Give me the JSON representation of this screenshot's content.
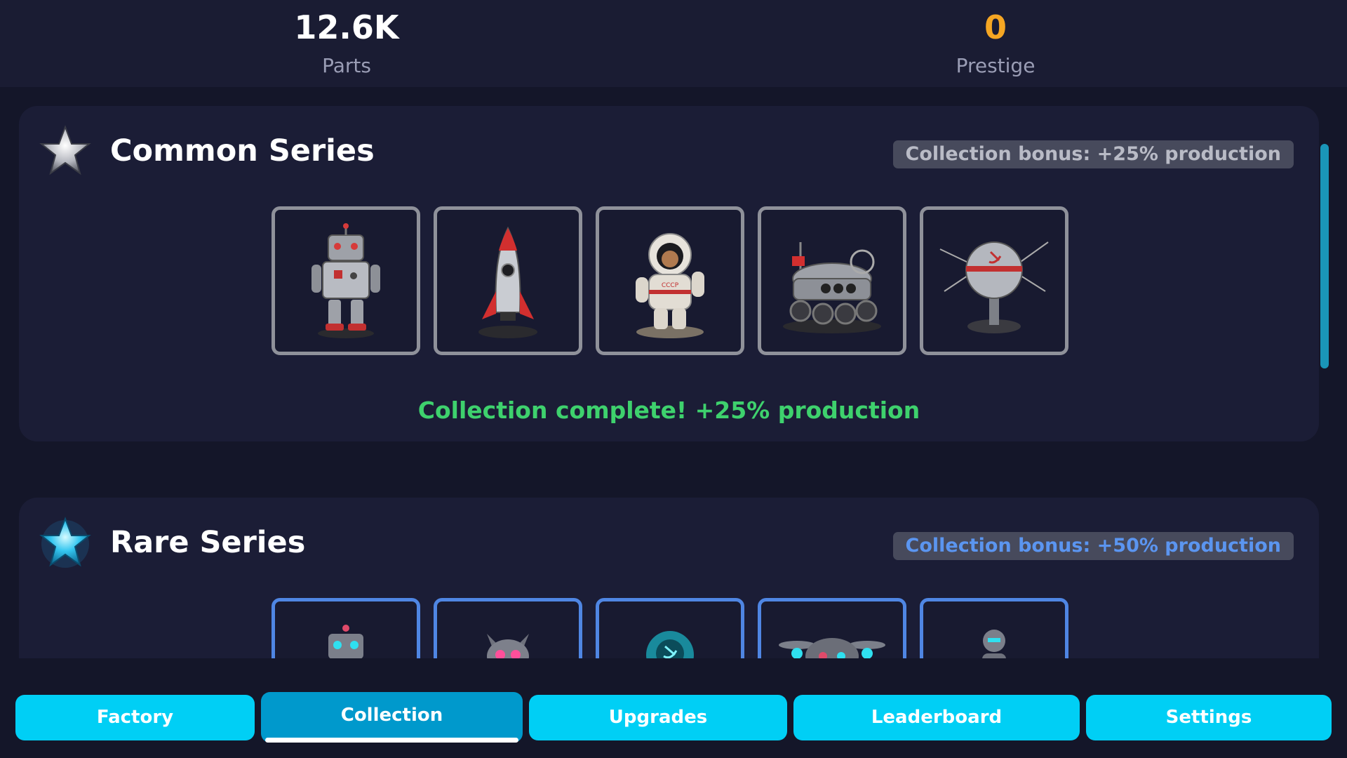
{
  "stats": {
    "parts": {
      "value": "12.6K",
      "label": "Parts"
    },
    "prestige": {
      "value": "0",
      "label": "Prestige"
    }
  },
  "series": {
    "common": {
      "title": "Common Series",
      "bonus": "Collection bonus: +25% production",
      "complete_text": "Collection complete! +25% production",
      "icon": "silver-star-icon",
      "items": [
        "robot-toy",
        "rocket-toy",
        "cosmonaut-toy",
        "lunar-rover-toy",
        "sputnik-toy"
      ]
    },
    "rare": {
      "title": "Rare Series",
      "bonus": "Collection bonus: +50% production",
      "icon": "cyan-star-icon",
      "items": [
        "rare-robot",
        "robot-cat",
        "hologram-cosmonaut",
        "drone-ship",
        "android-figure"
      ]
    }
  },
  "tabs": {
    "factory": "Factory",
    "collection": "Collection",
    "upgrades": "Upgrades",
    "leaderboard": "Leaderboard",
    "settings": "Settings",
    "active": "Collection"
  },
  "colors": {
    "background": "#141629",
    "card": "#1b1d36",
    "prestige": "#f5a623",
    "complete": "#3ed16d",
    "rare_accent": "#4f86e3",
    "tab": "#00cff5",
    "tab_active": "#0099cc"
  }
}
